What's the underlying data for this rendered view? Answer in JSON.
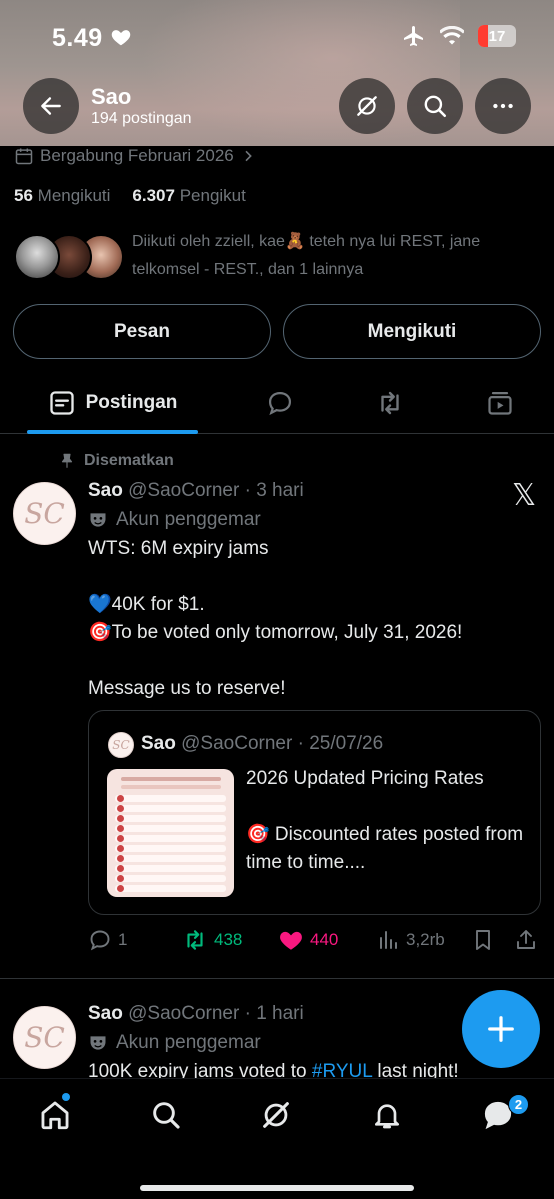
{
  "status_bar": {
    "time": "5.49",
    "battery": "17"
  },
  "header": {
    "name": "Sao",
    "post_count": "194 postingan"
  },
  "profile": {
    "joined": "Bergabung Februari 2026",
    "following_count": "56",
    "following_label": "Mengikuti",
    "followers_count": "6.307",
    "followers_label": "Pengikut",
    "followed_by": "Diikuti oleh zziell, kae🧸 teteh nya lui REST, jane telkomsel - REST., dan 1 lainnya",
    "message_button": "Pesan",
    "following_button": "Mengikuti"
  },
  "tabs": {
    "active_label": "Postingan"
  },
  "posts": [
    {
      "pinned_label": "Disematkan",
      "author": "Sao",
      "handle_time": "@SaoCorner · 3 hari",
      "fan_label": "Akun penggemar",
      "text": "WTS: 6M expiry jams\n\n💙40K for $1.\n🎯To be voted only tomorrow, July 31, 2026!\n\nMessage us to reserve!",
      "quote": {
        "author": "Sao",
        "handle_time": "@SaoCorner · 25/07/26",
        "text": "2026 Updated Pricing Rates\n\n🎯 Discounted rates posted from time to time...."
      },
      "replies": "1",
      "reposts": "438",
      "likes": "440",
      "views": "3,2rb"
    },
    {
      "author": "Sao",
      "handle_time": "@SaoCorner · 1 hari",
      "fan_label": "Akun penggemar",
      "text_before_link": "100K expiry jams voted to ",
      "text_link": "#RYUL",
      "text_after_link": " last night!"
    }
  ],
  "bottom_nav": {
    "messages_badge": "2"
  },
  "colors": {
    "accent": "#1d9bf0",
    "repost_green": "#00ba7c",
    "like_pink": "#f91880",
    "muted": "#71767b"
  }
}
